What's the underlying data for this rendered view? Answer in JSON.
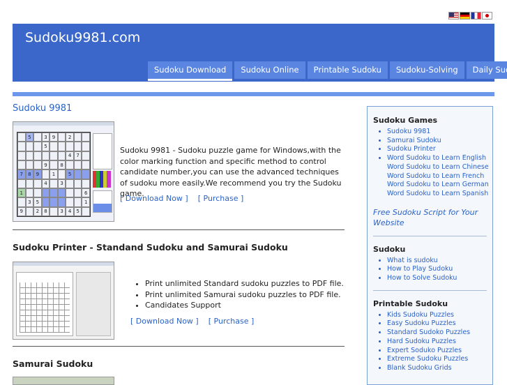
{
  "site": {
    "title": "Sudoku9981.com"
  },
  "flags": [
    "us-flag-icon",
    "de-flag-icon",
    "fr-flag-icon",
    "jp-flag-icon"
  ],
  "nav": {
    "tabs": [
      {
        "label": "Sudoku Download",
        "active": true
      },
      {
        "label": "Sudoku Online"
      },
      {
        "label": "Printable Sudoku"
      },
      {
        "label": "Sudoku-Solving"
      },
      {
        "label": "Daily Sudoku"
      }
    ]
  },
  "main": {
    "section1": {
      "title": "Sudoku 9981",
      "description": "Sudoku 9981 - Sudoku puzzle game for Windows,with the color marking function and specific method to control candidate number,you can use the advanced techniques of sudoku more easily.We recommend you try the Sudoku game.",
      "download": "[ Download Now ]",
      "purchase": "[ Purchase ]"
    },
    "section2": {
      "title": "Sudoku Printer - Standand Sudoku and Samurai Sudoku",
      "bullets": [
        "Print unlimited Standard sudoku puzzles to PDF file.",
        "Print unlimited Samurai sudoku puzzles to PDF file.",
        "Candidates Support"
      ],
      "download": "[ Download Now ]",
      "purchase": "[ Purchase ]"
    },
    "section3": {
      "title": "Samurai Sudoku"
    }
  },
  "sidebar": {
    "games": {
      "heading": "Sudoku Games",
      "items": [
        "Sudoku 9981",
        "Samurai Sudoku",
        "Sudoku Printer",
        "Word Sudoku to Learn English"
      ],
      "subitems": [
        "Word Sudoku to Learn Chinese",
        "Word Sudoku to Learn French",
        "Word Sudoku to Learn German",
        "Word Sudoku to Learn Spanish"
      ],
      "script_link": "Free Sudoku Script for Your Website"
    },
    "sudoku": {
      "heading": "Sudoku",
      "items": [
        "What is sudoku",
        "How to Play Sudoku",
        "How to Solve Sudoku"
      ]
    },
    "printable": {
      "heading": "Printable Sudoku",
      "items": [
        "Kids Sudoku Puzzles",
        "Easy Sudoku Puzzles",
        "Standard Sudoko Puzzles",
        "Hard Sudoku Puzzles",
        "Expert Soduko Puzzles",
        "Extreme Sudoku Puzzles",
        "Blank Sudoku Grids"
      ]
    }
  }
}
